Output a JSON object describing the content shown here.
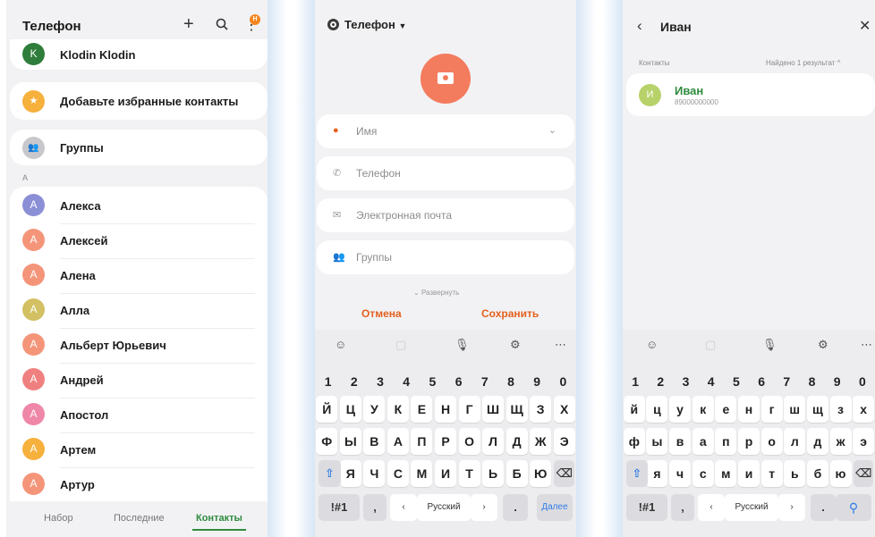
{
  "panel1": {
    "title": "Телефон",
    "badge": "Н",
    "top_contact": {
      "initial": "K",
      "name": "Klodin Klodin",
      "color": "#2e7d3a"
    },
    "favorites": "Добавьте избранные контакты",
    "groups": "Группы",
    "section": "А",
    "contacts": [
      {
        "initial": "А",
        "name": "Алекса",
        "color": "#8b8fd6"
      },
      {
        "initial": "А",
        "name": "Алексей",
        "color": "#f4957a"
      },
      {
        "initial": "А",
        "name": "Алена",
        "color": "#f4957a"
      },
      {
        "initial": "А",
        "name": "Алла",
        "color": "#d2c062"
      },
      {
        "initial": "А",
        "name": "Альберт Юрьевич",
        "color": "#f4957a"
      },
      {
        "initial": "А",
        "name": "Андрей",
        "color": "#f08080"
      },
      {
        "initial": "А",
        "name": "Апостол",
        "color": "#ef87a8"
      },
      {
        "initial": "А",
        "name": "Артем",
        "color": "#f6b03c"
      },
      {
        "initial": "А",
        "name": "Артур",
        "color": "#f4957a"
      }
    ],
    "tabs": [
      "Набор",
      "Последние",
      "Контакты"
    ]
  },
  "panel2": {
    "account": "Телефон",
    "fields": [
      "Имя",
      "Телефон",
      "Электронная почта",
      "Группы"
    ],
    "expand": "Развернуть",
    "cancel": "Отмена",
    "save": "Сохранить",
    "keyboard": {
      "numbers": [
        "1",
        "2",
        "3",
        "4",
        "5",
        "6",
        "7",
        "8",
        "9",
        "0"
      ],
      "row1": [
        "Й",
        "Ц",
        "У",
        "К",
        "Е",
        "Н",
        "Г",
        "Ш",
        "Щ",
        "З",
        "Х"
      ],
      "row2": [
        "Ф",
        "Ы",
        "В",
        "А",
        "П",
        "Р",
        "О",
        "Л",
        "Д",
        "Ж",
        "Э"
      ],
      "row3": [
        "Я",
        "Ч",
        "С",
        "М",
        "И",
        "Т",
        "Ь",
        "Б",
        "Ю"
      ],
      "sym": "!#1",
      "comma": ",",
      "lang": "Русский",
      "dot": ".",
      "action": "Далее"
    }
  },
  "panel3": {
    "title": "Иван",
    "contacts_label": "Контакты",
    "found_label": "Найдено 1 результат",
    "result": {
      "initial": "И",
      "name": "Иван",
      "phone": "89000000000"
    },
    "keyboard": {
      "numbers": [
        "1",
        "2",
        "3",
        "4",
        "5",
        "6",
        "7",
        "8",
        "9",
        "0"
      ],
      "row1": [
        "й",
        "ц",
        "у",
        "к",
        "е",
        "н",
        "г",
        "ш",
        "щ",
        "з",
        "х"
      ],
      "row2": [
        "ф",
        "ы",
        "в",
        "а",
        "п",
        "р",
        "о",
        "л",
        "д",
        "ж",
        "э"
      ],
      "row3": [
        "я",
        "ч",
        "с",
        "м",
        "и",
        "т",
        "ь",
        "б",
        "ю"
      ],
      "sym": "!#1",
      "comma": ",",
      "lang": "Русский",
      "dot": "."
    }
  }
}
